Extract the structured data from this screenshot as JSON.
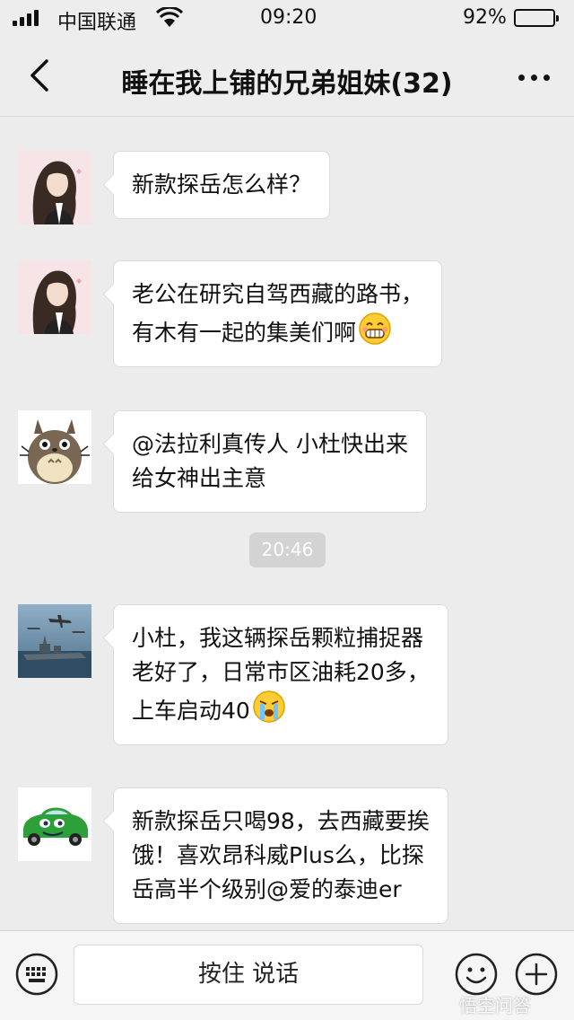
{
  "status_bar": {
    "carrier": "中国联通",
    "time": "09:20",
    "battery_percent": "92%",
    "battery_level": 0.92,
    "signal_bars": 4
  },
  "nav": {
    "title": "睡在我上铺的兄弟姐妹(32)",
    "back_icon": "chevron-left-icon",
    "more_icon": "more-dots-icon"
  },
  "messages": [
    {
      "avatar": "girl-avatar",
      "text": "新款探岳怎么样？",
      "emoji": ""
    },
    {
      "avatar": "girl-avatar",
      "text": "老公在研究自驾西藏的路书，\n有木有一起的集美们啊",
      "emoji": "grin-emoji"
    },
    {
      "avatar": "totoro-avatar",
      "text": "@法拉利真传人 小杜快出来\n给女神出主意",
      "emoji": ""
    },
    {
      "avatar": "warship-avatar",
      "text": "小杜，我这辆探岳颗粒捕捉器\n老好了，日常市区油耗20多，\n上车启动40",
      "emoji": "cry-emoji"
    },
    {
      "avatar": "green-car-avatar",
      "text": "新款探岳只喝98，去西藏要挨\n饿！喜欢昂科威Plus么，比探\n岳高半个级别@爱的泰迪er",
      "emoji": ""
    }
  ],
  "timestamp": "20:46",
  "input_bar": {
    "voice_label": "按住 说话",
    "keyboard_icon": "keyboard-icon",
    "emoji_icon": "smiley-icon",
    "plus_icon": "plus-icon"
  },
  "watermark": "悟空问答"
}
